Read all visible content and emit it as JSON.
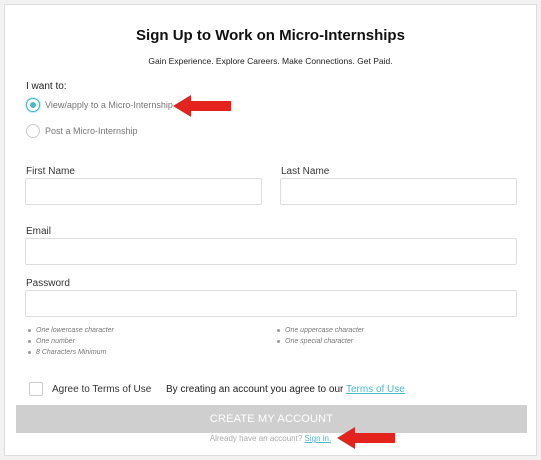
{
  "page": {
    "title": "Sign Up to Work on Micro-Internships",
    "subtitle": "Gain Experience. Explore Careers. Make Connections. Get Paid."
  },
  "intent": {
    "label": "I want to:",
    "options": [
      {
        "label": "View/apply to a Micro-Internship",
        "selected": true
      },
      {
        "label": "Post a Micro-Internship",
        "selected": false
      }
    ]
  },
  "form": {
    "first_name_label": "First Name",
    "first_name_value": "",
    "last_name_label": "Last Name",
    "last_name_value": "",
    "email_label": "Email",
    "email_value": "",
    "password_label": "Password",
    "password_value": ""
  },
  "password_requirements": {
    "left": [
      "One lowercase character",
      "One number",
      "8 Characters Minimum"
    ],
    "right": [
      "One uppercase character",
      "One special character"
    ]
  },
  "terms": {
    "checkbox_label": "Agree to Terms of Use",
    "consent_text": "By creating an account you agree to our ",
    "link_text": "Terms of Use",
    "checked": false
  },
  "actions": {
    "create_label": "CREATE MY ACCOUNT",
    "signin_prompt": "Already have an account? ",
    "signin_link": "Sign in."
  },
  "colors": {
    "accent": "#4bb8c6",
    "annotation_arrow": "#e3231c",
    "button_disabled": "#cfcfcf"
  },
  "icons": {
    "annotation": "red-arrow-icon"
  }
}
